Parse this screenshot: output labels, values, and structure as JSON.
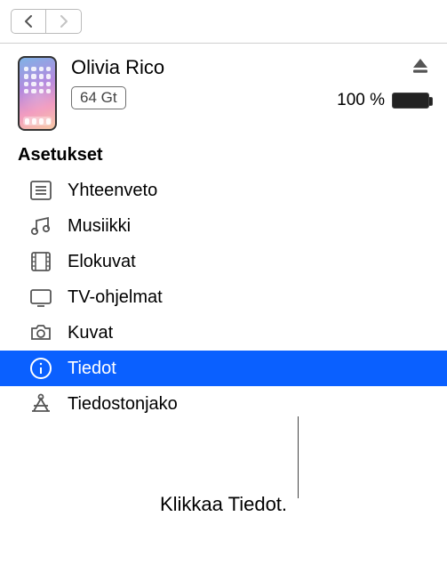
{
  "device": {
    "name": "Olivia Rico",
    "capacity": "64 Gt",
    "battery_text": "100 %"
  },
  "sidebar": {
    "title": "Asetukset",
    "items": [
      {
        "label": "Yhteenveto"
      },
      {
        "label": "Musiikki"
      },
      {
        "label": "Elokuvat"
      },
      {
        "label": "TV-ohjelmat"
      },
      {
        "label": "Kuvat"
      },
      {
        "label": "Tiedot"
      },
      {
        "label": "Tiedostonjako"
      }
    ],
    "selected_index": 5
  },
  "callout": {
    "text": "Klikkaa Tiedot."
  }
}
